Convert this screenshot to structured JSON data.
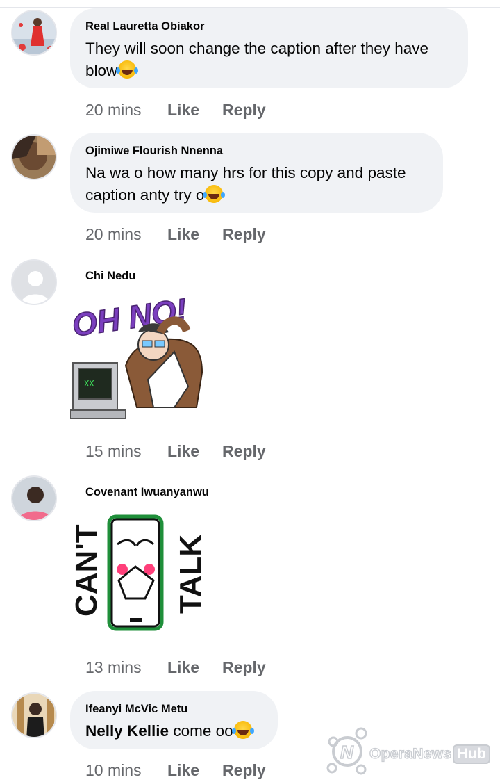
{
  "comments": [
    {
      "author": "Real Lauretta Obiakor",
      "text_line1": "They will soon change the caption after they have",
      "text_line2": "blow",
      "emoji": "laughing-tears-emoji",
      "time": "20 mins",
      "like": "Like",
      "reply": "Reply"
    },
    {
      "author": "Ojimiwe Flourish Nnenna",
      "text_line1": "Na wa o how many hrs for this copy and paste",
      "text_line2": "caption anty try o",
      "emoji": "laughing-cat-emoji",
      "time": "20 mins",
      "like": "Like",
      "reply": "Reply"
    },
    {
      "author": "Chi Nedu",
      "sticker_text": "OH NO!",
      "sticker": "oh-no-sticker",
      "time": "15 mins",
      "like": "Like",
      "reply": "Reply"
    },
    {
      "author": "Covenant Iwuanyanwu",
      "sticker_left": "CAN'T",
      "sticker_right": "TALK",
      "sticker": "cant-talk-sticker",
      "time": "13 mins",
      "like": "Like",
      "reply": "Reply"
    },
    {
      "author": "Ifeanyi McVic Metu",
      "mention": "Nelly Kellie",
      "text": " come oo",
      "emoji": "laughing-tears-emoji",
      "time": "10 mins",
      "like": "Like",
      "reply": "Reply"
    }
  ],
  "watermark": {
    "brand": "OperaNews",
    "hub": "Hub"
  },
  "colors": {
    "bubble": "#f0f2f5",
    "meta_text": "#65676b",
    "sticker_purple": "#7b3fbf",
    "phone_green": "#1db954"
  }
}
